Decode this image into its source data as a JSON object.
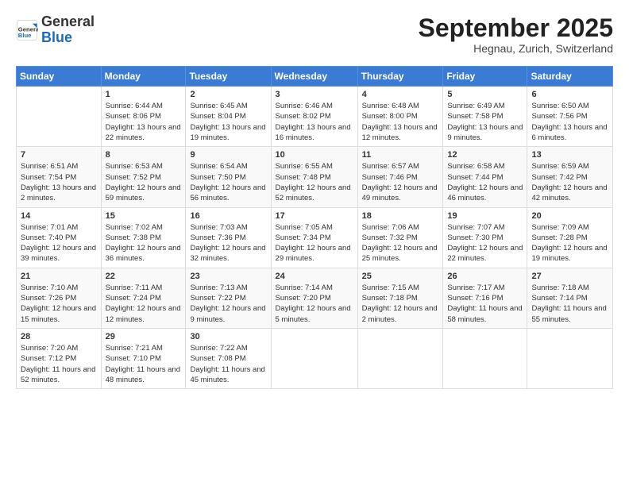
{
  "logo": {
    "general": "General",
    "blue": "Blue"
  },
  "title": "September 2025",
  "location": "Hegnau, Zurich, Switzerland",
  "weekdays": [
    "Sunday",
    "Monday",
    "Tuesday",
    "Wednesday",
    "Thursday",
    "Friday",
    "Saturday"
  ],
  "weeks": [
    [
      {
        "day": "",
        "sunrise": "",
        "sunset": "",
        "daylight": ""
      },
      {
        "day": "1",
        "sunrise": "Sunrise: 6:44 AM",
        "sunset": "Sunset: 8:06 PM",
        "daylight": "Daylight: 13 hours and 22 minutes."
      },
      {
        "day": "2",
        "sunrise": "Sunrise: 6:45 AM",
        "sunset": "Sunset: 8:04 PM",
        "daylight": "Daylight: 13 hours and 19 minutes."
      },
      {
        "day": "3",
        "sunrise": "Sunrise: 6:46 AM",
        "sunset": "Sunset: 8:02 PM",
        "daylight": "Daylight: 13 hours and 16 minutes."
      },
      {
        "day": "4",
        "sunrise": "Sunrise: 6:48 AM",
        "sunset": "Sunset: 8:00 PM",
        "daylight": "Daylight: 13 hours and 12 minutes."
      },
      {
        "day": "5",
        "sunrise": "Sunrise: 6:49 AM",
        "sunset": "Sunset: 7:58 PM",
        "daylight": "Daylight: 13 hours and 9 minutes."
      },
      {
        "day": "6",
        "sunrise": "Sunrise: 6:50 AM",
        "sunset": "Sunset: 7:56 PM",
        "daylight": "Daylight: 13 hours and 6 minutes."
      }
    ],
    [
      {
        "day": "7",
        "sunrise": "Sunrise: 6:51 AM",
        "sunset": "Sunset: 7:54 PM",
        "daylight": "Daylight: 13 hours and 2 minutes."
      },
      {
        "day": "8",
        "sunrise": "Sunrise: 6:53 AM",
        "sunset": "Sunset: 7:52 PM",
        "daylight": "Daylight: 12 hours and 59 minutes."
      },
      {
        "day": "9",
        "sunrise": "Sunrise: 6:54 AM",
        "sunset": "Sunset: 7:50 PM",
        "daylight": "Daylight: 12 hours and 56 minutes."
      },
      {
        "day": "10",
        "sunrise": "Sunrise: 6:55 AM",
        "sunset": "Sunset: 7:48 PM",
        "daylight": "Daylight: 12 hours and 52 minutes."
      },
      {
        "day": "11",
        "sunrise": "Sunrise: 6:57 AM",
        "sunset": "Sunset: 7:46 PM",
        "daylight": "Daylight: 12 hours and 49 minutes."
      },
      {
        "day": "12",
        "sunrise": "Sunrise: 6:58 AM",
        "sunset": "Sunset: 7:44 PM",
        "daylight": "Daylight: 12 hours and 46 minutes."
      },
      {
        "day": "13",
        "sunrise": "Sunrise: 6:59 AM",
        "sunset": "Sunset: 7:42 PM",
        "daylight": "Daylight: 12 hours and 42 minutes."
      }
    ],
    [
      {
        "day": "14",
        "sunrise": "Sunrise: 7:01 AM",
        "sunset": "Sunset: 7:40 PM",
        "daylight": "Daylight: 12 hours and 39 minutes."
      },
      {
        "day": "15",
        "sunrise": "Sunrise: 7:02 AM",
        "sunset": "Sunset: 7:38 PM",
        "daylight": "Daylight: 12 hours and 36 minutes."
      },
      {
        "day": "16",
        "sunrise": "Sunrise: 7:03 AM",
        "sunset": "Sunset: 7:36 PM",
        "daylight": "Daylight: 12 hours and 32 minutes."
      },
      {
        "day": "17",
        "sunrise": "Sunrise: 7:05 AM",
        "sunset": "Sunset: 7:34 PM",
        "daylight": "Daylight: 12 hours and 29 minutes."
      },
      {
        "day": "18",
        "sunrise": "Sunrise: 7:06 AM",
        "sunset": "Sunset: 7:32 PM",
        "daylight": "Daylight: 12 hours and 25 minutes."
      },
      {
        "day": "19",
        "sunrise": "Sunrise: 7:07 AM",
        "sunset": "Sunset: 7:30 PM",
        "daylight": "Daylight: 12 hours and 22 minutes."
      },
      {
        "day": "20",
        "sunrise": "Sunrise: 7:09 AM",
        "sunset": "Sunset: 7:28 PM",
        "daylight": "Daylight: 12 hours and 19 minutes."
      }
    ],
    [
      {
        "day": "21",
        "sunrise": "Sunrise: 7:10 AM",
        "sunset": "Sunset: 7:26 PM",
        "daylight": "Daylight: 12 hours and 15 minutes."
      },
      {
        "day": "22",
        "sunrise": "Sunrise: 7:11 AM",
        "sunset": "Sunset: 7:24 PM",
        "daylight": "Daylight: 12 hours and 12 minutes."
      },
      {
        "day": "23",
        "sunrise": "Sunrise: 7:13 AM",
        "sunset": "Sunset: 7:22 PM",
        "daylight": "Daylight: 12 hours and 9 minutes."
      },
      {
        "day": "24",
        "sunrise": "Sunrise: 7:14 AM",
        "sunset": "Sunset: 7:20 PM",
        "daylight": "Daylight: 12 hours and 5 minutes."
      },
      {
        "day": "25",
        "sunrise": "Sunrise: 7:15 AM",
        "sunset": "Sunset: 7:18 PM",
        "daylight": "Daylight: 12 hours and 2 minutes."
      },
      {
        "day": "26",
        "sunrise": "Sunrise: 7:17 AM",
        "sunset": "Sunset: 7:16 PM",
        "daylight": "Daylight: 11 hours and 58 minutes."
      },
      {
        "day": "27",
        "sunrise": "Sunrise: 7:18 AM",
        "sunset": "Sunset: 7:14 PM",
        "daylight": "Daylight: 11 hours and 55 minutes."
      }
    ],
    [
      {
        "day": "28",
        "sunrise": "Sunrise: 7:20 AM",
        "sunset": "Sunset: 7:12 PM",
        "daylight": "Daylight: 11 hours and 52 minutes."
      },
      {
        "day": "29",
        "sunrise": "Sunrise: 7:21 AM",
        "sunset": "Sunset: 7:10 PM",
        "daylight": "Daylight: 11 hours and 48 minutes."
      },
      {
        "day": "30",
        "sunrise": "Sunrise: 7:22 AM",
        "sunset": "Sunset: 7:08 PM",
        "daylight": "Daylight: 11 hours and 45 minutes."
      },
      {
        "day": "",
        "sunrise": "",
        "sunset": "",
        "daylight": ""
      },
      {
        "day": "",
        "sunrise": "",
        "sunset": "",
        "daylight": ""
      },
      {
        "day": "",
        "sunrise": "",
        "sunset": "",
        "daylight": ""
      },
      {
        "day": "",
        "sunrise": "",
        "sunset": "",
        "daylight": ""
      }
    ]
  ]
}
